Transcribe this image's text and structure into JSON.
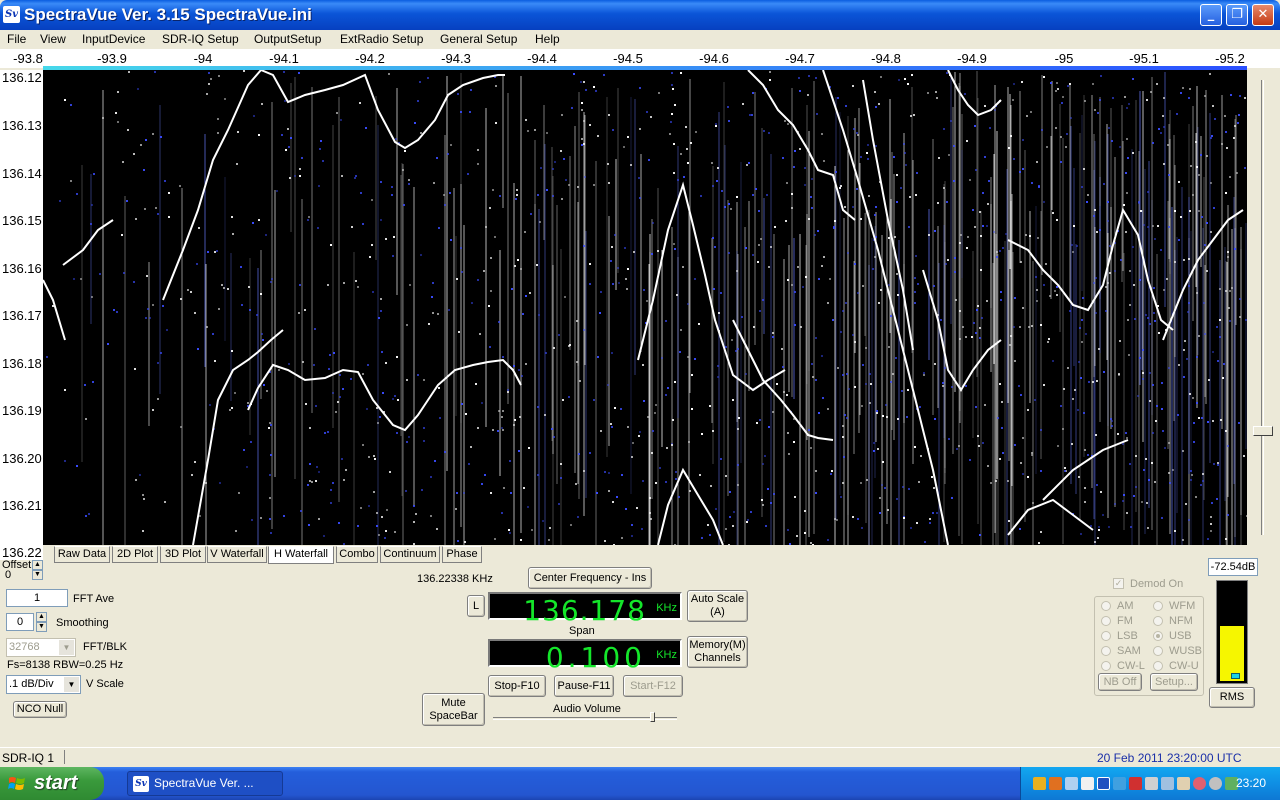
{
  "window": {
    "title": "SpectraVue Ver. 3.15  SpectraVue.ini",
    "icon": "Sv",
    "controls": {
      "minimize": "_",
      "maximize": "❐",
      "close": "✕"
    }
  },
  "menu": [
    "File",
    "View",
    "InputDevice",
    "SDR-IQ Setup",
    "OutputSetup",
    "ExtRadio Setup",
    "General Setup",
    "Help"
  ],
  "freq_axis": [
    "-93.8",
    "-93.9",
    "-94",
    "-94.1",
    "-94.2",
    "-94.3",
    "-94.4",
    "-94.5",
    "-94.6",
    "-94.7",
    "-94.8",
    "-94.9",
    "-95",
    "-95.1",
    "-95.2"
  ],
  "time_axis": [
    "136.12",
    "136.13",
    "136.14",
    "136.15",
    "136.16",
    "136.17",
    "136.18",
    "136.19",
    "136.20",
    "136.21",
    "136.22"
  ],
  "tabs": [
    "Raw Data",
    "2D Plot",
    "3D Plot",
    "V Waterfall",
    "H Waterfall",
    "Combo",
    "Continuum",
    "Phase"
  ],
  "active_tab": "H Waterfall",
  "left_panel": {
    "offset_label": "Offset",
    "offset_value": "0",
    "fft_ave_value": "1",
    "fft_ave_label": "FFT Ave",
    "smoothing_value": "0",
    "smoothing_label": "Smoothing",
    "fft_blk_value": "32768",
    "fft_blk_label": "FFT/BLK",
    "fs_info": "Fs=8138 RBW=0.25 Hz",
    "vscale_value": ".1 dB/Div",
    "vscale_label": "V Scale",
    "nco_null": "NCO Null"
  },
  "center": {
    "cursor_freq": "136.22338 KHz",
    "center_freq_button": "Center Frequency - Ins",
    "lock_button": "L",
    "freq_value": "136.178",
    "freq_unit": "KHz",
    "span_label": "Span",
    "span_value": "0.100",
    "span_unit": "KHz",
    "auto_scale_line1": "Auto Scale",
    "auto_scale_line2": "(A)",
    "memory_line1": "Memory(M)",
    "memory_line2": "Channels",
    "stop_button": "Stop-F10",
    "pause_button": "Pause-F11",
    "start_button": "Start-F12",
    "mute_line1": "Mute",
    "mute_line2": "SpaceBar",
    "audio_volume_label": "Audio Volume"
  },
  "right_panel": {
    "level_readout": "-72.54dB",
    "meter_fill_fraction": 0.55,
    "rms_button": "RMS",
    "demod_label": "Demod On",
    "modes": [
      "AM",
      "WFM",
      "FM",
      "NFM",
      "LSB",
      "USB",
      "SAM",
      "WUSB",
      "CW-L",
      "CW-U"
    ],
    "selected_mode": "USB",
    "nb_off": "NB Off",
    "setup": "Setup..."
  },
  "status": {
    "device": "SDR-IQ 1",
    "datetime": "20 Feb 2011  23:20:00 UTC"
  },
  "taskbar": {
    "start": "start",
    "task": "SpectraVue Ver. ...",
    "clock": "23:20"
  },
  "colors": {
    "lcd_text": "#14e62a",
    "waterfall_bg": "#000000",
    "meter_fill": "#f6f600",
    "titlebar": "#0a5de0"
  }
}
